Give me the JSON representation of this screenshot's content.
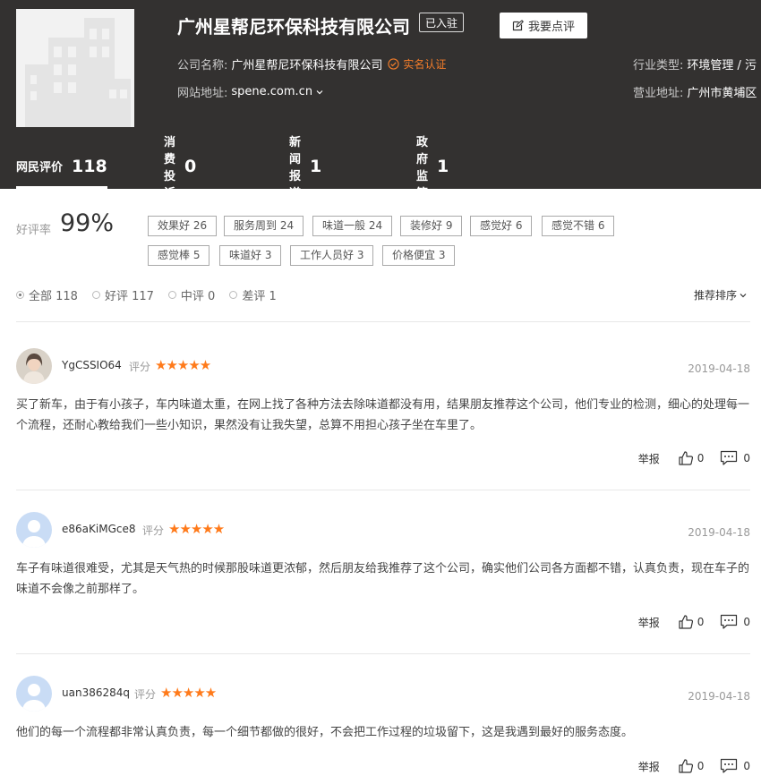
{
  "company": {
    "name": "广州星帮尼环保科技有限公司",
    "settled_badge": "已入驻",
    "review_button": "我要点评",
    "name_label": "公司名称:",
    "name_value": "广州星帮尼环保科技有限公司",
    "verified_label": "实名认证",
    "website_label": "网站地址:",
    "website_value": "spene.com.cn",
    "industry_label": "行业类型:",
    "industry_value": "环境管理 / 污",
    "address_label": "营业地址:",
    "address_value": "广州市黄埔区"
  },
  "tabs": [
    {
      "label": "网民评价",
      "count": "118"
    },
    {
      "label": "消费投诉",
      "count": "0"
    },
    {
      "label": "新闻报道",
      "count": "1"
    },
    {
      "label": "政府监管",
      "count": "1"
    }
  ],
  "rating": {
    "label": "好评率",
    "value": "99%"
  },
  "tags": [
    "效果好 26",
    "服务周到 24",
    "味道一般 24",
    "装修好 9",
    "感觉好 6",
    "感觉不错 6",
    "感觉棒 5",
    "味道好 3",
    "工作人员好 3",
    "价格便宜 3"
  ],
  "filters": [
    "全部 118",
    "好评 117",
    "中评 0",
    "差评 1"
  ],
  "sort_label": "推荐排序",
  "reviews": [
    {
      "user": "YgCSSIO64",
      "score_label": "评分",
      "stars": "★★★★★",
      "date": "2019-04-18",
      "content": "买了新车，由于有小孩子，车内味道太重，在网上找了各种方法去除味道都没有用，结果朋友推荐这个公司，他们专业的检测，细心的处理每一个流程，还耐心教给我们一些小知识，果然没有让我失望，总算不用担心孩子坐在车里了。",
      "report": "举报",
      "likes": "0",
      "comments": "0"
    },
    {
      "user": "e86aKiMGce8",
      "score_label": "评分",
      "stars": "★★★★★",
      "date": "2019-04-18",
      "content": "车子有味道很难受，尤其是天气热的时候那股味道更浓郁，然后朋友给我推荐了这个公司，确实他们公司各方面都不错，认真负责，现在车子的味道不会像之前那样了。",
      "report": "举报",
      "likes": "0",
      "comments": "0"
    },
    {
      "user": "uan386284q",
      "score_label": "评分",
      "stars": "★★★★★",
      "date": "2019-04-18",
      "content": "他们的每一个流程都非常认真负责，每一个细节都做的很好，不会把工作过程的垃圾留下，这是我遇到最好的服务态度。",
      "report": "举报",
      "likes": "0",
      "comments": "0"
    }
  ]
}
